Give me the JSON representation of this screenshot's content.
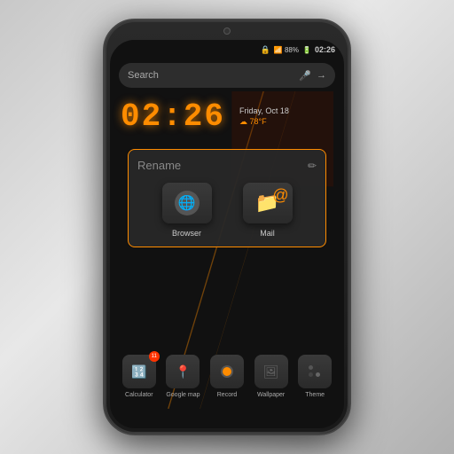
{
  "device": {
    "status_bar": {
      "lock": "🔒",
      "signal": "📶 88%",
      "battery": "🔋",
      "time": "02:26"
    },
    "search": {
      "placeholder": "Search"
    },
    "clock": {
      "time": "02:26",
      "date": "Friday, Oct 18",
      "weather": "☁ 78°F"
    },
    "rename_popup": {
      "title": "Rename",
      "apps": [
        {
          "label": "Browser",
          "icon": "globe"
        },
        {
          "label": "Mail",
          "icon": "mail"
        }
      ]
    },
    "bottom_apps": [
      {
        "label": "Calculator",
        "icon": "calc",
        "badge": "11"
      },
      {
        "label": "Google map",
        "icon": "map",
        "badge": null
      },
      {
        "label": "Record",
        "icon": "record",
        "badge": null
      },
      {
        "label": "Wallpaper",
        "icon": "wallpaper",
        "badge": null
      },
      {
        "label": "Theme",
        "icon": "theme",
        "badge": null
      }
    ]
  }
}
